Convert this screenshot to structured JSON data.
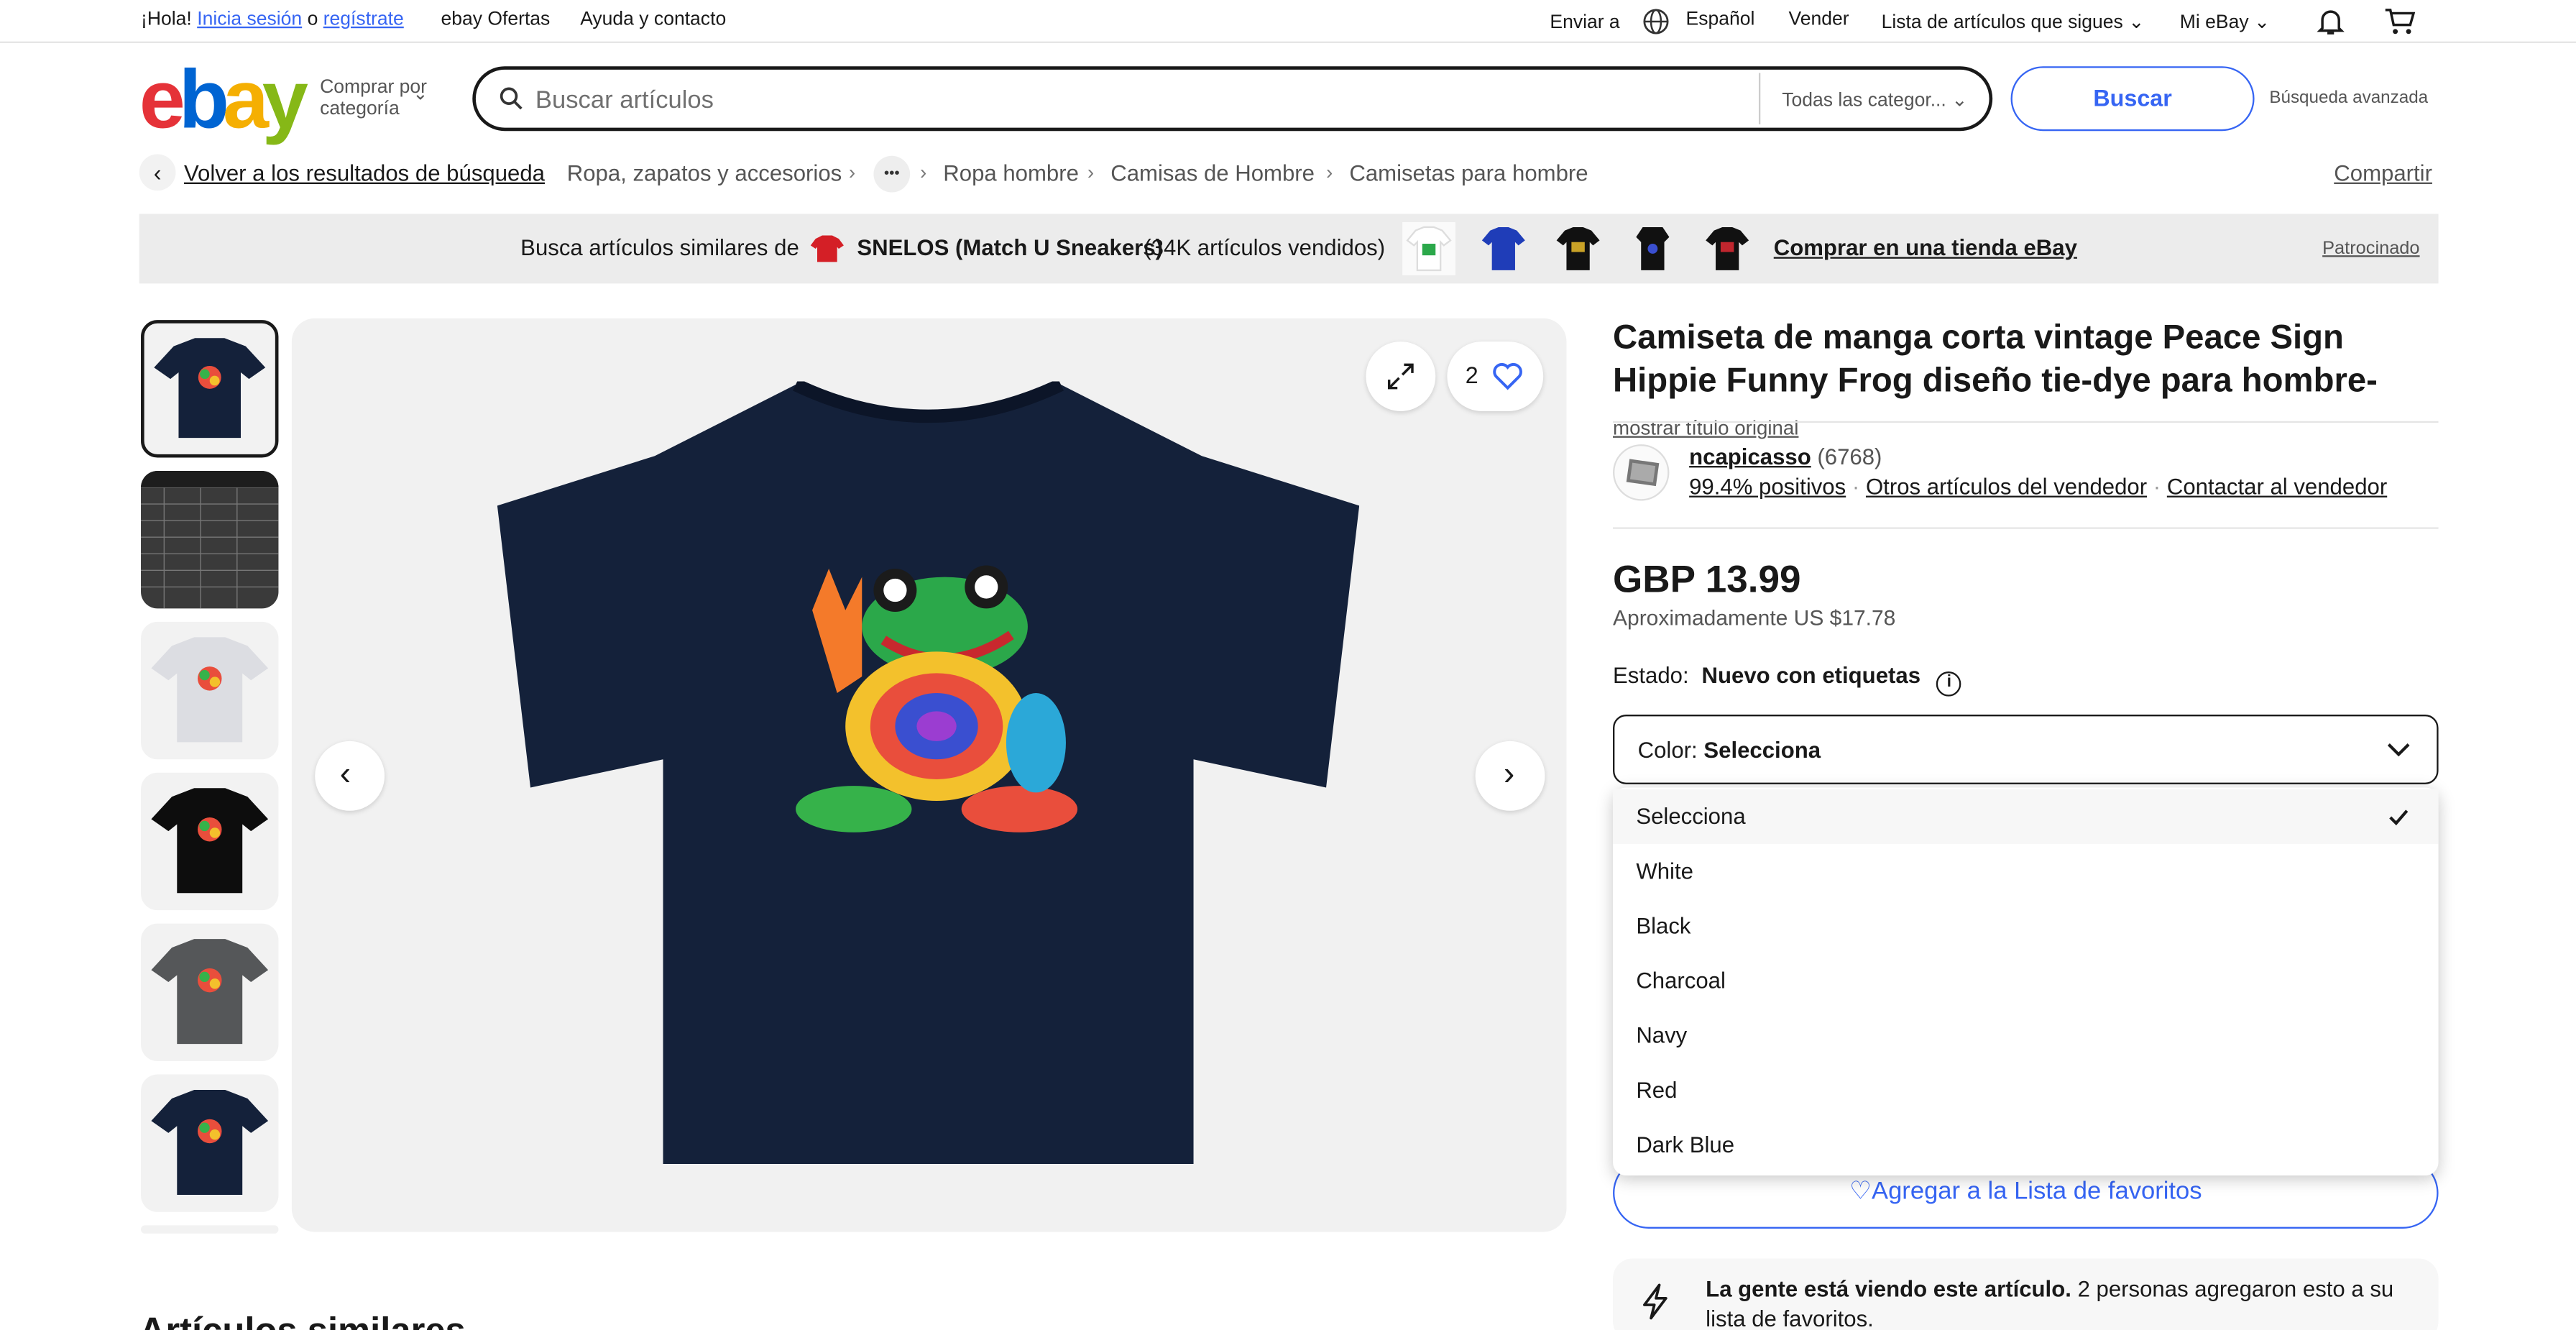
{
  "topbar": {
    "greeting": "¡Hola!",
    "sign_in": "Inicia sesión",
    "or": "o",
    "register": "regístrate",
    "deals": "ebay Ofertas",
    "help": "Ayuda y contacto",
    "ship_to": "Enviar a",
    "language": "Español",
    "sell": "Vender",
    "watchlist": "Lista de artículos que sigues",
    "my_ebay": "Mi eBay"
  },
  "header": {
    "shop_by_line1": "Comprar por",
    "shop_by_line2": "categoría",
    "search_placeholder": "Buscar artículos",
    "category_select": "Todas las categor...",
    "search_button": "Buscar",
    "advanced": "Búsqueda avanzada"
  },
  "breadcrumb": {
    "back": "Volver a los resultados de búsqueda",
    "items": [
      "Ropa, zapatos y accesorios",
      "Ropa hombre",
      "Camisas de Hombre",
      "Camisetas para hombre"
    ],
    "ellipsis": "•••",
    "share": "Compartir"
  },
  "banner": {
    "prefix": "Busca artículos similares de",
    "store": "SNELOS (Match U Sneakers)",
    "sold": "(34K artículos vendidos)",
    "cta": "Comprar en una tienda eBay",
    "sponsored": "Patrocinado"
  },
  "gallery": {
    "watch_count": "2"
  },
  "product": {
    "title": "Camiseta de manga corta vintage Peace Sign Hippie Funny Frog diseño tie-dye para hombre-",
    "show_original": "mostrar título original",
    "seller_name": "ncapicasso",
    "seller_count": "(6768)",
    "positive": "99.4% positivos",
    "other_items": "Otros artículos del vendedor",
    "contact": "Contactar al vendedor",
    "price": "GBP 13.99",
    "approx": "Aproximadamente US $17.78",
    "condition_label": "Estado:",
    "condition_value": "Nuevo con etiquetas",
    "color_label": "Color:",
    "color_value": "Selecciona",
    "color_options": [
      "Selecciona",
      "White",
      "Black",
      "Charcoal",
      "Navy",
      "Red",
      "Dark Blue"
    ],
    "favorites_button": "Agregar a la Lista de favoritos",
    "watching_bold": "La gente está viendo este artículo.",
    "watching_rest": "2 personas agregaron esto a su lista de favoritos."
  },
  "similar_heading": "Artículos similares",
  "colors": {
    "accent": "#3665f3",
    "navy_shirt": "#14213a"
  }
}
